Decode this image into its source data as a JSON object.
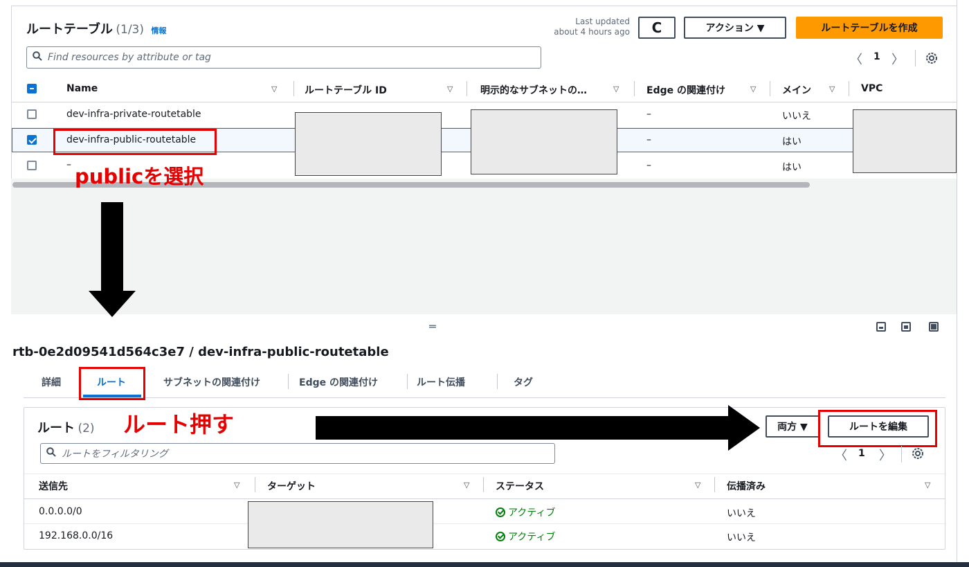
{
  "top": {
    "title": "ルートテーブル",
    "count": "(1/3)",
    "info": "情報",
    "last_updated_line1": "Last updated",
    "last_updated_line2": "about 4 hours ago",
    "refresh_icon": "C",
    "actions_label": "アクション ▼",
    "create_label": "ルートテーブルを作成",
    "search_placeholder": "Find resources by attribute or tag",
    "page": "1",
    "prev": "〈",
    "next": "〉"
  },
  "table": {
    "headers": [
      "Name",
      "ルートテーブル ID",
      "明示的なサブネットの…",
      "Edge の関連付け",
      "メイン",
      "VPC"
    ],
    "sort_glyph": "▽",
    "rows": [
      {
        "name": "dev-infra-private-routetable",
        "edge": "–",
        "main": "いいえ"
      },
      {
        "name": "dev-infra-public-routetable",
        "edge": "–",
        "main": "はい"
      },
      {
        "name": "–",
        "edge": "–",
        "main": "はい"
      }
    ]
  },
  "annotations": {
    "select_public": "publicを選択",
    "press_route": "ルート押す"
  },
  "detail": {
    "heading": "rtb-0e2d09541d564c3e7 / dev-infra-public-routetable",
    "tabs": [
      "詳細",
      "ルート",
      "サブネットの関連付け",
      "Edge の関連付け",
      "ルート伝播",
      "タグ"
    ],
    "routes_title": "ルート",
    "routes_count": "(2)",
    "filter_label": "両方 ▼",
    "edit_label": "ルートを編集",
    "search_placeholder": "ルートをフィルタリング",
    "page": "1",
    "prev": "〈",
    "next": "〉",
    "headers": [
      "送信先",
      "ターゲット",
      "ステータス",
      "伝播済み"
    ],
    "sort_glyph": "▽",
    "rows": [
      {
        "dest": "0.0.0.0/0",
        "status": "アクティブ",
        "propagated": "いいえ"
      },
      {
        "dest": "192.168.0.0/16",
        "status": "アクティブ",
        "propagated": "いいえ"
      }
    ],
    "resize_handle": "═"
  },
  "colors": {
    "accent": "#0972d3",
    "primary_button": "#ff9900",
    "annotation_red": "#e60000",
    "status_green": "#037f0c"
  }
}
